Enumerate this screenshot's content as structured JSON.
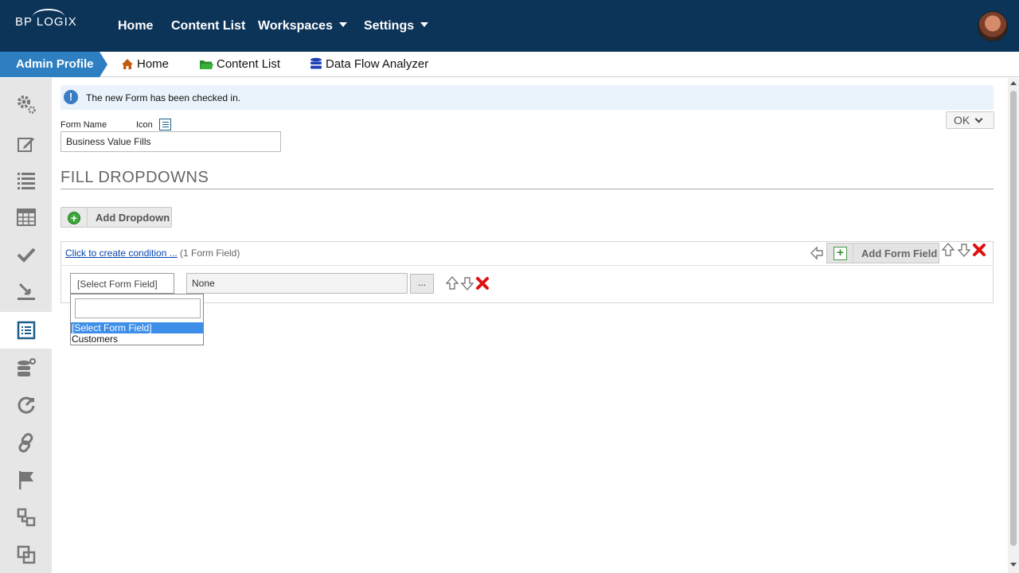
{
  "brand": {
    "logo_text": "BP LOGIX"
  },
  "topnav": {
    "items": [
      {
        "label": "Home"
      },
      {
        "label": "Content List"
      },
      {
        "label": "Workspaces"
      },
      {
        "label": "Settings"
      }
    ]
  },
  "breadcrumb": {
    "profile_label": "Admin Profile",
    "links": [
      {
        "label": "Home",
        "icon": "home-icon"
      },
      {
        "label": "Content List",
        "icon": "folder-icon"
      },
      {
        "label": "Data Flow Analyzer",
        "icon": "database-icon"
      }
    ]
  },
  "sidebar": {
    "items": [
      {
        "icon": "gears-icon"
      },
      {
        "icon": "edit-icon"
      },
      {
        "icon": "list-icon"
      },
      {
        "icon": "table-icon"
      },
      {
        "icon": "checkmark-icon"
      },
      {
        "icon": "import-icon"
      },
      {
        "icon": "form-icon",
        "active": true
      },
      {
        "icon": "database-add-icon"
      },
      {
        "icon": "dashboard-icon"
      },
      {
        "icon": "link-icon"
      },
      {
        "icon": "flag-icon"
      },
      {
        "icon": "hierarchy-icon"
      },
      {
        "icon": "copy-icon"
      }
    ]
  },
  "alert": {
    "message": "The new Form has been checked in."
  },
  "ok_button": {
    "label": "OK"
  },
  "form": {
    "name_label": "Form Name",
    "icon_label": "Icon",
    "name_value": "Business Value Fills"
  },
  "section": {
    "title": "FILL DROPDOWNS"
  },
  "add_dropdown": {
    "label": "Add Dropdown"
  },
  "condition": {
    "link_text": "Click to create condition ...",
    "count_text": "(1 Form Field)"
  },
  "add_form_field": {
    "label": "Add Form Field"
  },
  "field_row": {
    "select_value": "[Select Form Field]",
    "source_value": "None",
    "browse_label": "..."
  },
  "dropdown_options": [
    {
      "label": "[Select Form Field]",
      "selected": true
    },
    {
      "label": "Customers",
      "selected": false
    }
  ],
  "colors": {
    "topnav_bg": "#0c3358",
    "profile_tab": "#2e7fc2",
    "alert_bg": "#eaf3fb",
    "delete_red": "#e01010"
  }
}
